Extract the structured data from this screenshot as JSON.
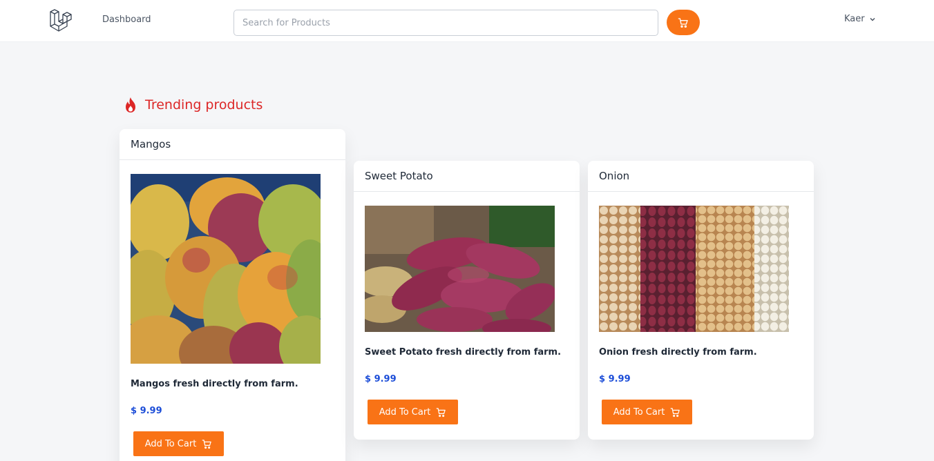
{
  "navbar": {
    "dashboard_label": "Dashboard",
    "search_placeholder": "Search for Products",
    "search_value": "",
    "user_name": "Kaer",
    "accent_color": "#f97316"
  },
  "section": {
    "title": "Trending products",
    "title_color": "#dc2626",
    "icon": "fire-icon"
  },
  "products": [
    {
      "name": "Mangos",
      "description": "Mangos fresh directly from farm.",
      "price": "$ 9.99",
      "button_label": "Add To Cart",
      "image": "mangos-photo"
    },
    {
      "name": "Sweet Potato",
      "description": "Sweet Potato fresh directly from farm.",
      "price": "$ 9.99",
      "button_label": "Add To Cart",
      "image": "sweet-potato-photo"
    },
    {
      "name": "Onion",
      "description": "Onion fresh directly from farm.",
      "price": "$ 9.99",
      "button_label": "Add To Cart",
      "image": "onion-photo"
    }
  ]
}
